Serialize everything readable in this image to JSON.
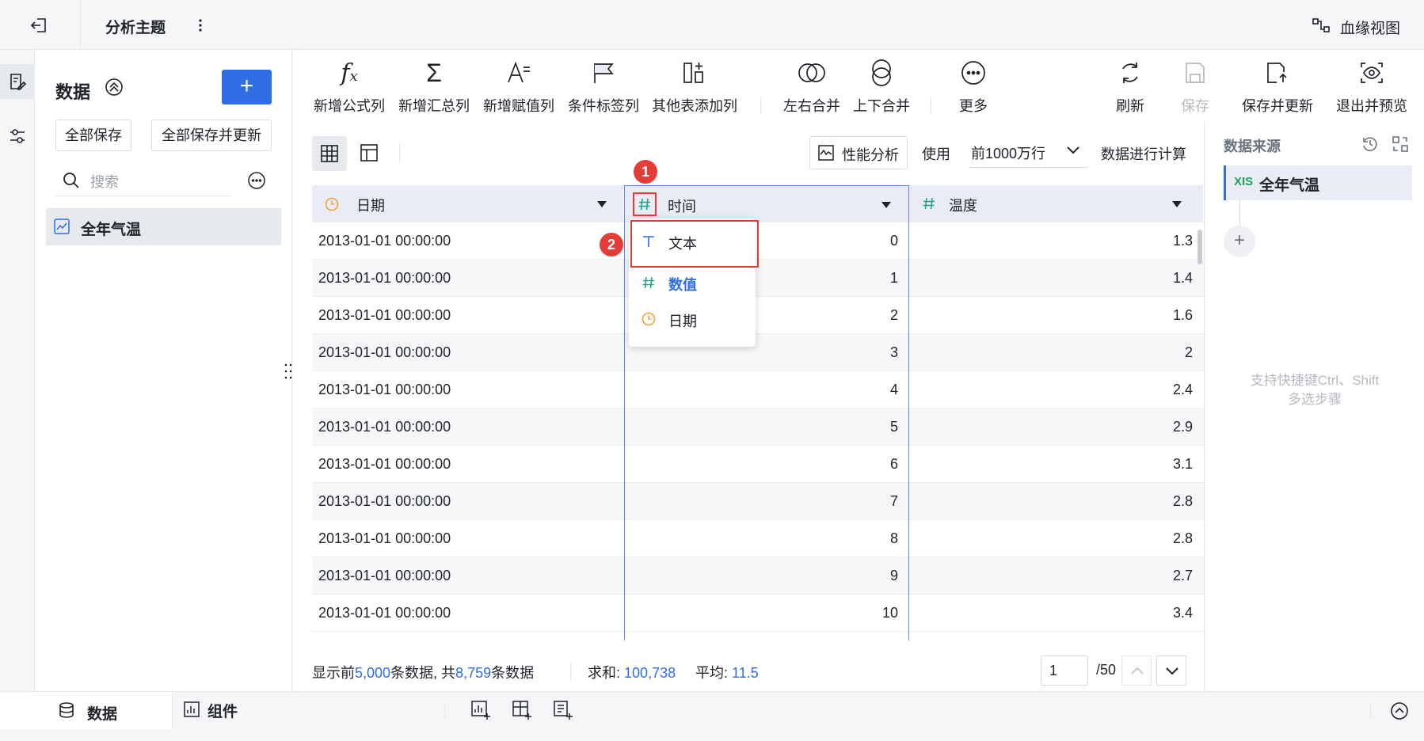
{
  "topbar": {
    "title": "分析主题",
    "lineage_label": "血缘视图"
  },
  "datapanel": {
    "title": "数据",
    "add_label": "+",
    "save_all": "全部保存",
    "save_all_update": "全部保存并更新",
    "search_placeholder": "搜索",
    "items": [
      {
        "label": "全年气温"
      }
    ]
  },
  "toolbar": {
    "add_formula": "新增公式列",
    "add_summary": "新增汇总列",
    "add_assign": "新增赋值列",
    "cond_label": "条件标签列",
    "other_table": "其他表添加列",
    "merge_lr": "左右合并",
    "merge_tb": "上下合并",
    "more": "更多",
    "refresh": "刷新",
    "save": "保存",
    "save_update": "保存并更新",
    "exit_preview": "退出并预览"
  },
  "subbar": {
    "perf_label": "性能分析",
    "use_label": "使用",
    "rows_select": "前1000万行",
    "calc_label": "数据进行计算"
  },
  "grid": {
    "columns": [
      {
        "name": "日期",
        "type": "date"
      },
      {
        "name": "时间",
        "type": "number"
      },
      {
        "name": "温度",
        "type": "number"
      }
    ],
    "rows": [
      [
        "2013-01-01 00:00:00",
        "0",
        "1.3"
      ],
      [
        "2013-01-01 00:00:00",
        "1",
        "1.4"
      ],
      [
        "2013-01-01 00:00:00",
        "2",
        "1.6"
      ],
      [
        "2013-01-01 00:00:00",
        "3",
        "2"
      ],
      [
        "2013-01-01 00:00:00",
        "4",
        "2.4"
      ],
      [
        "2013-01-01 00:00:00",
        "5",
        "2.9"
      ],
      [
        "2013-01-01 00:00:00",
        "6",
        "3.1"
      ],
      [
        "2013-01-01 00:00:00",
        "7",
        "2.8"
      ],
      [
        "2013-01-01 00:00:00",
        "8",
        "2.8"
      ],
      [
        "2013-01-01 00:00:00",
        "9",
        "2.7"
      ],
      [
        "2013-01-01 00:00:00",
        "10",
        "3.4"
      ]
    ]
  },
  "type_menu": {
    "items": [
      {
        "label": "文本"
      },
      {
        "label": "数值"
      },
      {
        "label": "日期"
      }
    ],
    "selected": "数值"
  },
  "annotations": {
    "badge1": "1",
    "badge2": "2"
  },
  "status": {
    "prefix": "显示前",
    "shown": "5,000",
    "mid": "条数据, 共",
    "total": "8,759",
    "suffix": "条数据",
    "sum_label": "求和:",
    "sum_value": "100,738",
    "avg_label": "平均:",
    "avg_value": "11.5",
    "page_value": "1",
    "page_total": "/50"
  },
  "rightpanel": {
    "title": "数据来源",
    "source_label": "全年气温",
    "xls_badge": "XIS",
    "add_label": "+",
    "hint_line1": "支持快捷键Ctrl、Shift",
    "hint_line2": "多选步骤"
  },
  "bottom": {
    "tab_data": "数据",
    "tab_component": "组件"
  },
  "colors": {
    "accent": "#2f6ee3",
    "header_bg": "#e9ecf5",
    "badge": "#e43d37",
    "highlight_border": "#e43d37",
    "date_icon": "#f0a23a",
    "number_icon": "#22a18b"
  }
}
